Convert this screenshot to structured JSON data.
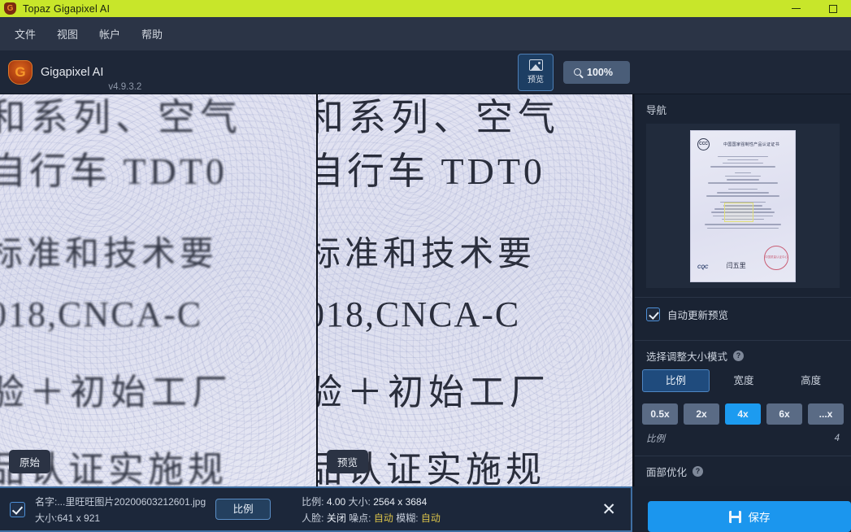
{
  "window": {
    "title": "Topaz Gigapixel AI",
    "logo_icon": "topaz-shield-icon",
    "minimize_icon": "minimize-icon",
    "maximize_icon": "maximize-icon",
    "titlebar_color": "#c8e62a"
  },
  "menubar": {
    "items": [
      {
        "label": "文件"
      },
      {
        "label": "视图"
      },
      {
        "label": "帐户"
      },
      {
        "label": "帮助"
      }
    ]
  },
  "toolbar": {
    "app_name": "Gigapixel AI",
    "version": "v4.9.3.2",
    "preview_button": {
      "label": "预览",
      "icon": "image-icon"
    },
    "zoom_button": {
      "label": "100%",
      "icon": "magnifier-icon"
    }
  },
  "viewer": {
    "original": {
      "badge": "原始",
      "lines": [
        "和系列、空气",
        "自行车 TDT0",
        "标准和技术要",
        "018,CNCA-C",
        "验＋初始工厂",
        "品认证实施规"
      ]
    },
    "preview": {
      "badge": "预览",
      "lines": [
        "和系列、空气",
        "自行车 TDT0",
        "标准和技术要",
        "018,CNCA-C",
        "验＋初始工厂",
        "品认证实施规"
      ]
    }
  },
  "right_panel": {
    "nav_title": "导航",
    "nav_thumbnail": {
      "badge_text": "CCC",
      "doc_title": "中国国家强制性产品认证证书",
      "footer_mark": "CQC",
      "signature": "闫五里",
      "stamp_text": "中国质量认证中心"
    },
    "auto_preview": {
      "label": "自动更新预览",
      "checked": true,
      "icon": "checkbox-checked-icon"
    },
    "resize_mode": {
      "label": "选择调整大小模式",
      "help_icon": "help-icon",
      "options": [
        {
          "label": "比例",
          "active": true
        },
        {
          "label": "宽度",
          "active": false
        },
        {
          "label": "高度",
          "active": false
        }
      ]
    },
    "scale_buttons": [
      {
        "label": "0.5x",
        "active": false
      },
      {
        "label": "2x",
        "active": false
      },
      {
        "label": "4x",
        "active": true
      },
      {
        "label": "6x",
        "active": false
      },
      {
        "label": "...x",
        "active": false
      }
    ],
    "ratio_row": {
      "label": "比例",
      "value": "4"
    },
    "face_refinement": {
      "label": "面部优化",
      "help_icon": "help-icon"
    },
    "accent_color": "#1c9bf0"
  },
  "bottom_bar": {
    "file_checked": true,
    "file_name": "名字:...里旺旺图片20200603212601.jpg",
    "file_size": "大小:641 x 921",
    "ratio_button": "比例",
    "out_scale_label": "比例:",
    "out_scale_value": "4.00",
    "out_size_label": "大小:",
    "out_size_value": "2564 x 3684",
    "face_label": "人脸:",
    "face_value": "关闭",
    "noise_label": "噪点:",
    "noise_value": "自动",
    "blur_label": "模糊:",
    "blur_value": "自动",
    "close_icon": "close-icon",
    "save_button": {
      "label": "保存",
      "icon": "save-icon"
    }
  }
}
